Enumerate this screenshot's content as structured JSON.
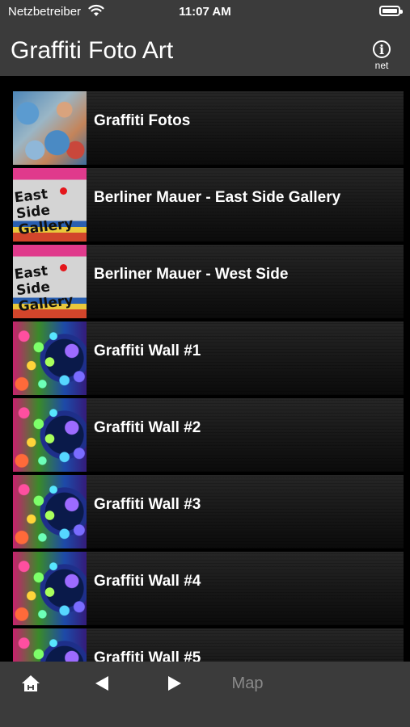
{
  "status_bar": {
    "carrier": "Netzbetreiber",
    "time": "11:07 AM",
    "wifi_icon": "wifi-icon",
    "battery_icon": "battery-icon"
  },
  "nav": {
    "title": "Graffiti Foto Art",
    "info_button_sub": "net",
    "info_icon": "info-icon"
  },
  "list": {
    "items": [
      {
        "label": "Graffiti Fotos"
      },
      {
        "label": "Berliner Mauer - East Side Gallery",
        "thumb_text": "East Side Gallery"
      },
      {
        "label": "Berliner Mauer - West Side",
        "thumb_text": "East Side Gallery"
      },
      {
        "label": "Graffiti Wall #1"
      },
      {
        "label": "Graffiti Wall #2"
      },
      {
        "label": "Graffiti Wall #3"
      },
      {
        "label": "Graffiti Wall #4"
      },
      {
        "label": "Graffiti Wall #5"
      }
    ]
  },
  "toolbar": {
    "home_icon": "home-icon",
    "back_icon": "back-arrow-icon",
    "forward_icon": "forward-arrow-icon",
    "map_label": "Map"
  },
  "colors": {
    "bar_background": "#3b3b3b",
    "list_background": "#000000",
    "text": "#ffffff",
    "disabled_text": "#8a8a8a"
  }
}
